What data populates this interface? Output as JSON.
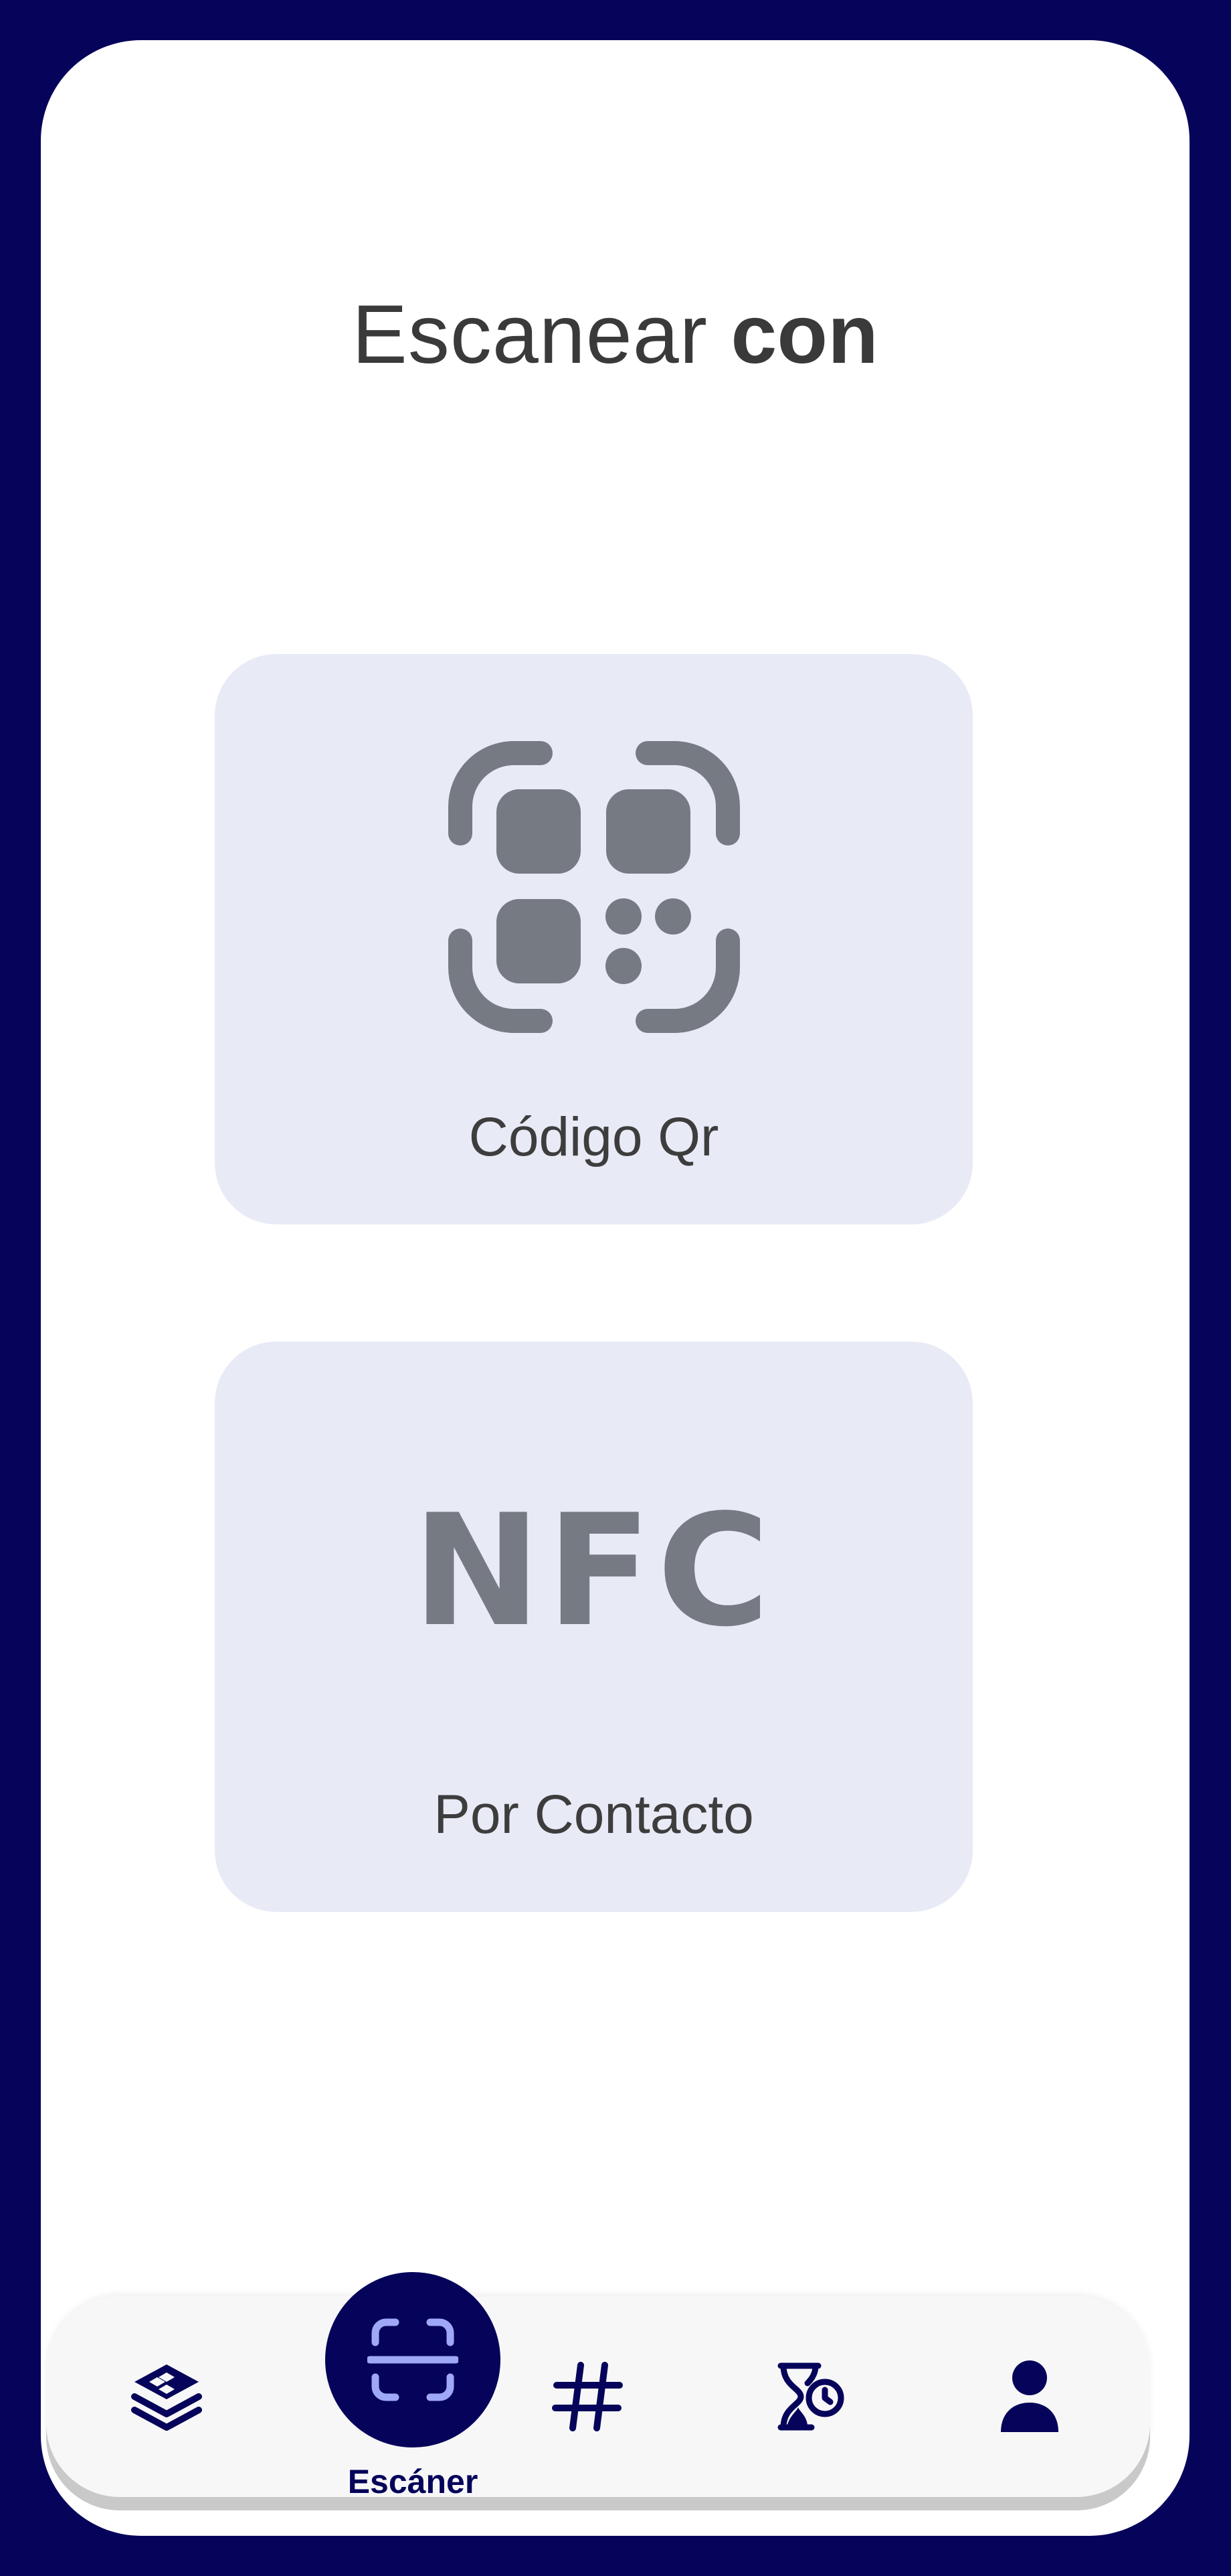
{
  "screen": {
    "title_light": "Escanear",
    "title_bold": "con"
  },
  "options": [
    {
      "icon": "qr-scan-icon",
      "label": "Código Qr"
    },
    {
      "icon": "nfc-icon",
      "icon_text": "NFC",
      "label": "Por Contacto"
    }
  ],
  "bottom_nav": {
    "items": [
      {
        "icon": "layers-icon"
      },
      {
        "icon": "scan-icon",
        "label": "Escáner",
        "active": true
      },
      {
        "icon": "hashtag-icon"
      },
      {
        "icon": "hourglass-clock-icon"
      },
      {
        "icon": "user-icon"
      }
    ]
  },
  "colors": {
    "frame": "#06045a",
    "card_bg": "#e8eaf6",
    "icon_gray": "#767a82",
    "fab_icon": "#9fa8f7",
    "nav_bg": "#f7f7f8"
  }
}
